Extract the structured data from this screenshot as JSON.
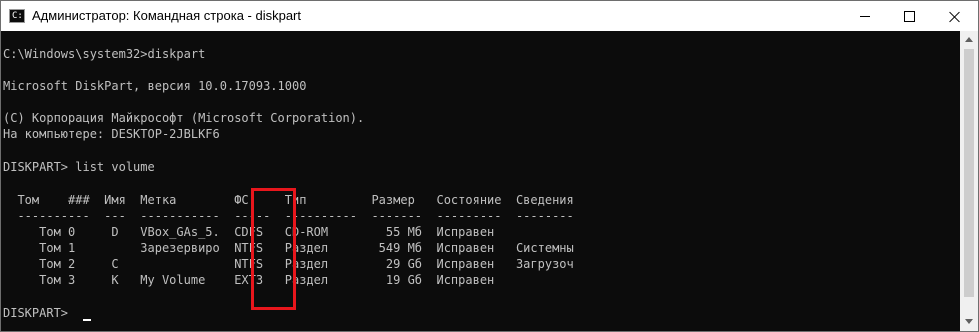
{
  "window": {
    "title": "Администратор: Командная строка - diskpart",
    "icon": "cmd-icon",
    "controls": {
      "minimize": "minimize-icon",
      "maximize": "maximize-icon",
      "close": "close-icon"
    }
  },
  "console": {
    "lines": [
      "C:\\Windows\\system32>diskpart",
      "",
      "Microsoft DiskPart, версия 10.0.17093.1000",
      "",
      "(C) Корпорация Майкрософт (Microsoft Corporation).",
      "На компьютере: DESKTOP-2JBLKF6",
      "",
      "DISKPART> list volume",
      "",
      "  Том    ###  Имя  Метка        ФС     Тип         Размер   Состояние  Сведения",
      "  ----------  ---  -----------  -----  ----------  -------  ---------  --------",
      "     Том 0     D   VBox_GAs_5.  CDFS   CD-ROM        55 Мб  Исправен",
      "     Том 1         Зарезервиро  NTFS   Раздел       549 Мб  Исправен   Системны",
      "     Том 2     C                NTFS   Раздел        29 Gб  Исправен   Загрузоч",
      "     Том 3     K   My Volume    EXT3   Раздел        19 Gб  Исправен",
      "",
      "DISKPART> "
    ]
  },
  "colors": {
    "console_bg": "#0c0c0c",
    "console_text": "#c0c0c0",
    "highlight": "#e8161c"
  }
}
